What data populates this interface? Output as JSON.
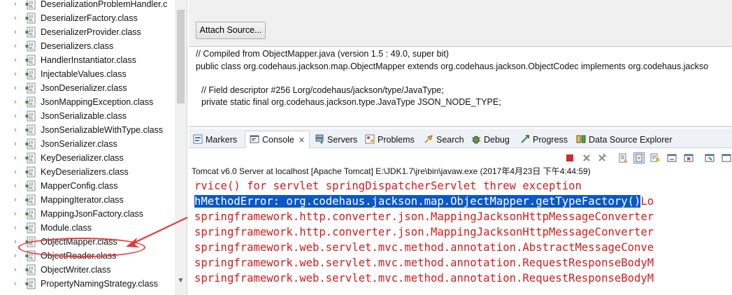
{
  "tree": {
    "items": [
      {
        "label": "DeserializationProblemHandler.c"
      },
      {
        "label": "DeserializerFactory.class"
      },
      {
        "label": "DeserializerProvider.class"
      },
      {
        "label": "Deserializers.class"
      },
      {
        "label": "HandlerInstantiator.class"
      },
      {
        "label": "InjectableValues.class"
      },
      {
        "label": "JsonDeserializer.class"
      },
      {
        "label": "JsonMappingException.class"
      },
      {
        "label": "JsonSerializable.class"
      },
      {
        "label": "JsonSerializableWithType.class"
      },
      {
        "label": "JsonSerializer.class"
      },
      {
        "label": "KeyDeserializer.class"
      },
      {
        "label": "KeyDeserializers.class"
      },
      {
        "label": "MapperConfig.class"
      },
      {
        "label": "MappingIterator.class"
      },
      {
        "label": "MappingJsonFactory.class"
      },
      {
        "label": "Module.class"
      },
      {
        "label": "ObjectMapper.class"
      },
      {
        "label": "ObjectReader.class"
      },
      {
        "label": "ObjectWriter.class"
      },
      {
        "label": "PropertyNamingStrategy.class"
      }
    ],
    "highlighted_item": "ObjectMapper.class"
  },
  "source": {
    "attach_button": "Attach Source...",
    "lines": [
      "// Compiled from ObjectMapper.java (version 1.5 : 49.0, super bit)",
      "public class org.codehaus.jackson.map.ObjectMapper extends org.codehaus.jackson.ObjectCodec implements org.codehaus.jackso",
      "// Field descriptor #256 Lorg/codehaus/jackson/type/JavaType;",
      "private static final org.codehaus.jackson.type.JavaType JSON_NODE_TYPE;"
    ]
  },
  "tabs": [
    {
      "label": "Markers",
      "icon": "markers-icon"
    },
    {
      "label": "Console",
      "icon": "console-icon",
      "active": true,
      "close": "✕"
    },
    {
      "label": "Servers",
      "icon": "servers-icon"
    },
    {
      "label": "Problems",
      "icon": "problems-icon"
    },
    {
      "label": "Search",
      "icon": "search-icon"
    },
    {
      "label": "Debug",
      "icon": "debug-icon"
    },
    {
      "label": "Progress",
      "icon": "progress-icon"
    },
    {
      "label": "Data Source Explorer",
      "icon": "data-source-explorer-icon"
    }
  ],
  "console": {
    "header": "Tomcat v6.0 Server at localhost [Apache Tomcat] E:\\JDK1.7\\jre\\bin\\javaw.exe (2017年4月23日 下午4:44:59)",
    "lines": [
      {
        "text": "rvice() for servlet springDispatcherServlet threw exception"
      },
      {
        "pre": "",
        "selected": "hMethodError: org.codehaus.jackson.map.ObjectMapper.getTypeFactory()",
        "post": "Lo"
      },
      {
        "text": "springframework.http.converter.json.MappingJacksonHttpMessageConverter"
      },
      {
        "text": "springframework.http.converter.json.MappingJacksonHttpMessageConverter"
      },
      {
        "text": "springframework.web.servlet.mvc.method.annotation.AbstractMessageConve"
      },
      {
        "text": "springframework.web.servlet.mvc.method.annotation.RequestResponseBodyM"
      },
      {
        "text": "springframework.web.servlet.mvc.method.annotation.RequestResponseBodyM"
      }
    ]
  },
  "colors": {
    "console_error": "#d51c1c",
    "selection": "#0a58c9",
    "annotation": "#e4393c"
  }
}
